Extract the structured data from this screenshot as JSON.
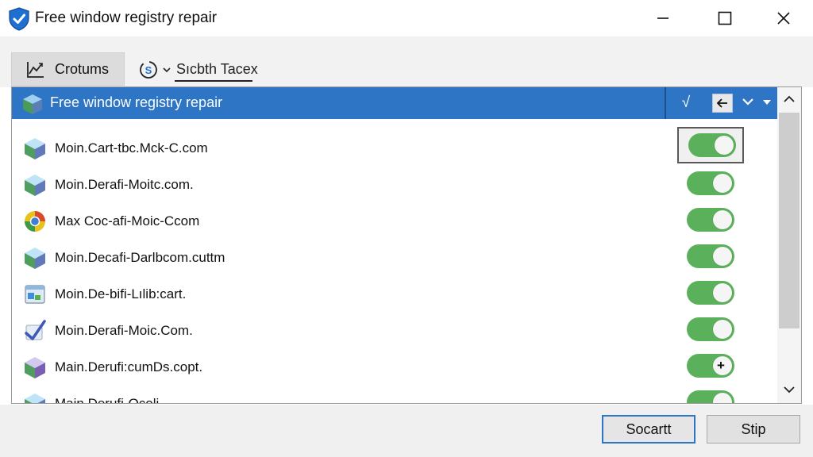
{
  "window": {
    "title": "Free window registry repair",
    "controls": {
      "minimize_icon": "minimize-icon",
      "maximize_icon": "maximize-icon",
      "close_icon": "close-icon"
    }
  },
  "toolbar": {
    "tabs": [
      {
        "label": "Crotums",
        "icon": "chart-icon",
        "active": true
      },
      {
        "label": "Sıcbth Tacex",
        "icon": "scan-icon",
        "active": false
      }
    ]
  },
  "list": {
    "header": {
      "label": "Free window registry repair",
      "check_mark": "√"
    },
    "rows": [
      {
        "label": "Moin.Cart-tbc.Mck-C.com",
        "icon": "package-icon",
        "toggle_on": true,
        "focused": true
      },
      {
        "label": "Moin.Derafi-Moitc.com.",
        "icon": "package-icon",
        "toggle_on": true
      },
      {
        "label": "Max Coc-afi-Moic-Ccom",
        "icon": "browser-icon",
        "toggle_on": true
      },
      {
        "label": "Moin.Decafi-Darlbcom.cuttm",
        "icon": "package-icon",
        "toggle_on": true
      },
      {
        "label": "Moin.De-bifi-Lılib:cart.",
        "icon": "window-app-icon",
        "toggle_on": true
      },
      {
        "label": "Moin.Derafi-Moic.Com.",
        "icon": "checkmark-app-icon",
        "toggle_on": true
      },
      {
        "label": "Main.Derufi:cumDs.copt.",
        "icon": "package-icon",
        "toggle_on": true,
        "knob_plus": "+"
      },
      {
        "label": "Main.Derufi-Ocoli",
        "icon": "package-icon",
        "toggle_on": true
      }
    ]
  },
  "buttons": {
    "primary": "Socartt",
    "secondary": "Stip"
  },
  "colors": {
    "accent": "#2f75c6",
    "toggle_on": "#5bb15b",
    "scroll_thumb": "#cdcdcd"
  }
}
